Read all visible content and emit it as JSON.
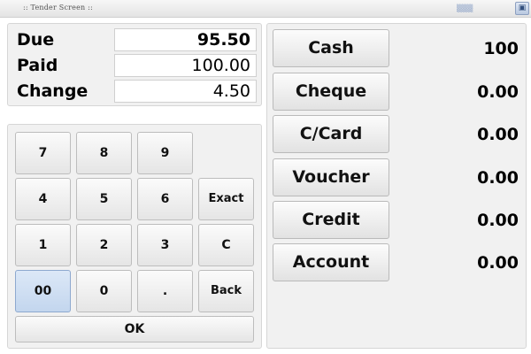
{
  "window": {
    "title": ":: Tender Screen ::",
    "controls_text": "▒▒▒",
    "close_glyph": "▣"
  },
  "summary": {
    "due_label": "Due",
    "due_value": "95.50",
    "paid_label": "Paid",
    "paid_value": "100.00",
    "change_label": "Change",
    "change_value": "4.50"
  },
  "keypad": {
    "k7": "7",
    "k8": "8",
    "k9": "9",
    "k4": "4",
    "k5": "5",
    "k6": "6",
    "exact": "Exact",
    "k1": "1",
    "k2": "2",
    "k3": "3",
    "clear": "C",
    "k00": "00",
    "k0": "0",
    "dot": ".",
    "back": "Back",
    "ok": "OK"
  },
  "tenders": [
    {
      "label": "Cash",
      "amount": "100"
    },
    {
      "label": "Cheque",
      "amount": "0.00"
    },
    {
      "label": "C/Card",
      "amount": "0.00"
    },
    {
      "label": "Voucher",
      "amount": "0.00"
    },
    {
      "label": "Credit",
      "amount": "0.00"
    },
    {
      "label": "Account",
      "amount": "0.00"
    }
  ]
}
